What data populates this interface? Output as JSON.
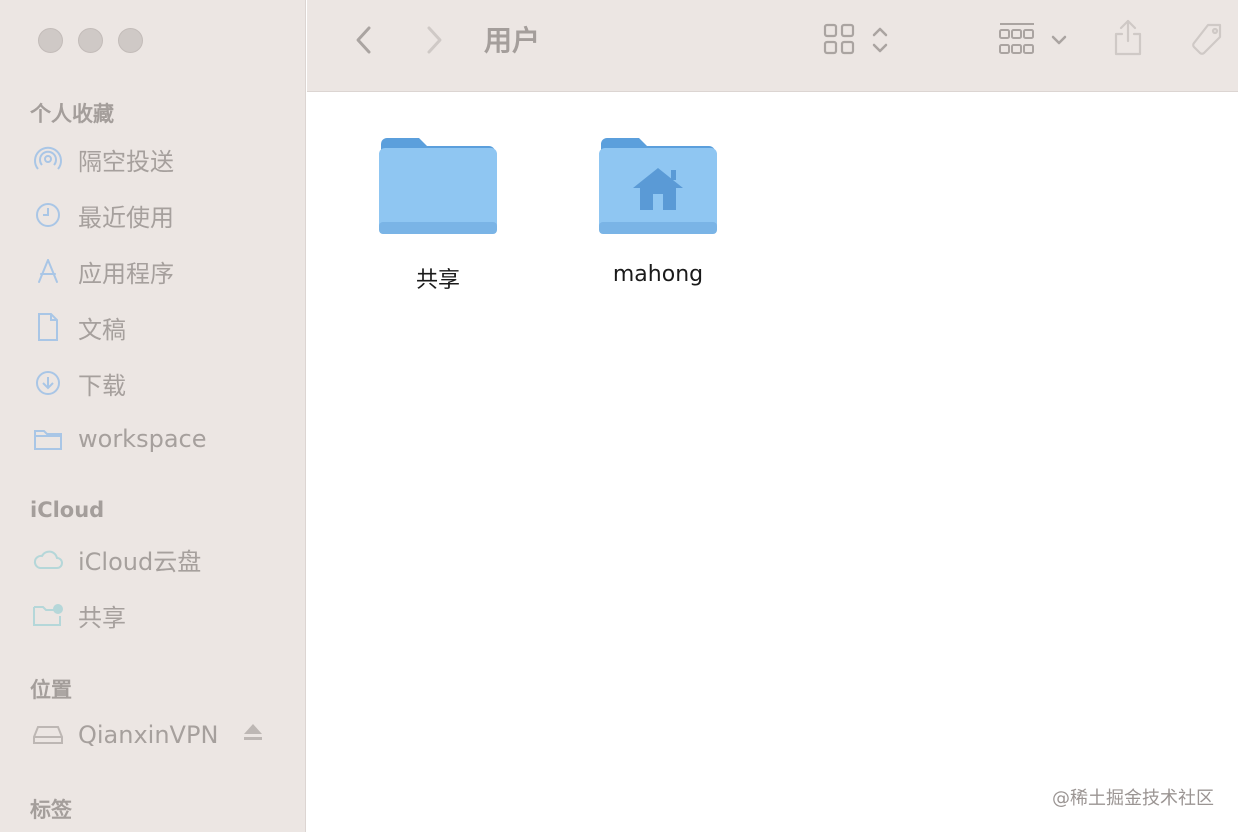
{
  "window": {
    "title": "用户"
  },
  "sidebar": {
    "sections": [
      {
        "title": "个人收藏"
      },
      {
        "title": "iCloud"
      },
      {
        "title": "位置"
      },
      {
        "title": "标签"
      }
    ],
    "favorites": [
      {
        "label": "隔空投送",
        "icon": "airdrop-icon"
      },
      {
        "label": "最近使用",
        "icon": "clock-icon"
      },
      {
        "label": "应用程序",
        "icon": "applications-icon"
      },
      {
        "label": "文稿",
        "icon": "document-icon"
      },
      {
        "label": "下载",
        "icon": "download-icon"
      },
      {
        "label": "workspace",
        "icon": "folder-icon"
      }
    ],
    "icloud": [
      {
        "label": "iCloud云盘",
        "icon": "cloud-icon"
      },
      {
        "label": "共享",
        "icon": "shared-folder-icon"
      }
    ],
    "locations": [
      {
        "label": "QianxinVPN",
        "icon": "drive-icon",
        "action_icon": "eject-icon"
      }
    ]
  },
  "files": [
    {
      "name": "共享",
      "icon": "folder-icon"
    },
    {
      "name": "mahong",
      "icon": "home-folder-icon"
    }
  ],
  "toolbar": {
    "icons": [
      "back-icon",
      "forward-icon",
      "icon-view-icon",
      "sort-chevrons-icon",
      "group-icon",
      "chevron-down-icon",
      "share-icon",
      "tag-icon"
    ]
  },
  "colors": {
    "sidebar_bg": "#ece6e3",
    "sidebar_text": "#a6a09d",
    "accent_blue": "#8fc6f2",
    "folder_tab": "#5b9fdc"
  },
  "watermark": "@稀土掘金技术社区"
}
